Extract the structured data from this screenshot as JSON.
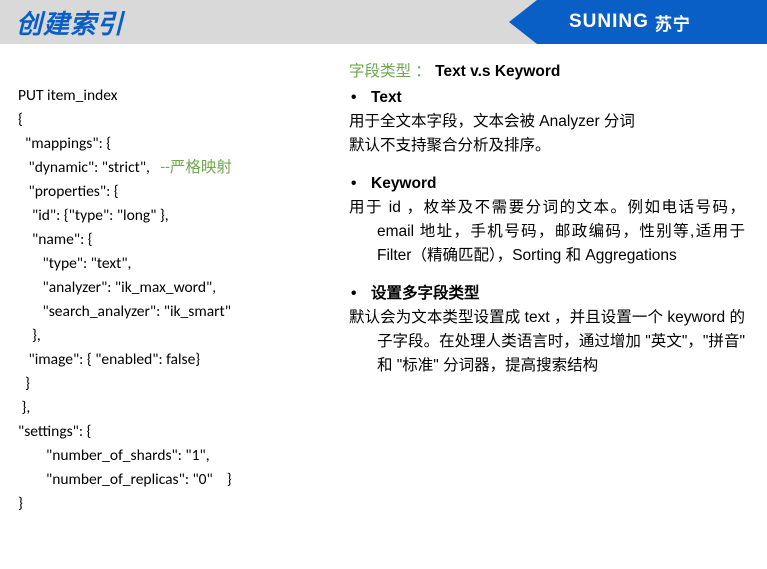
{
  "header": {
    "title": "创建索引",
    "brand_en": "SUNING",
    "brand_cn": "苏宁"
  },
  "code": {
    "l1": "PUT item_index",
    "l2": "{",
    "l3": "  \"mappings\": {",
    "l4a": "   \"dynamic\": \"strict\",   ",
    "l4b": "--严格映射",
    "l5": "   \"properties\": {",
    "l6": "    \"id\": {\"type\": \"long\" },",
    "l7": "    \"name\": {",
    "l8": "       \"type\": \"text\",",
    "l9": "       \"analyzer\": \"ik_max_word\",",
    "l10": "       \"search_analyzer\": \"ik_smart\"",
    "l11": "    },",
    "l12": "   \"image\": { \"enabled\": false}",
    "l13": "  }",
    "l14": " },",
    "l15": "\"settings\": {",
    "l16": "        \"number_of_shards\": \"1\",",
    "l17": "        \"number_of_replicas\": \"0\"    }",
    "l18": "}"
  },
  "right": {
    "section_label": "字段类型 ：",
    "section_kw": "Text v.s Keyword",
    "text_bullet": "Text",
    "text_desc1": "用于全文本字段，文本会被 Analyzer 分词",
    "text_desc2": "默认不支持聚合分析及排序。",
    "keyword_bullet": "Keyword",
    "keyword_desc1": "用于 id ，枚举及不需要分词的文本。例如电话号码，email 地址，手机号码，邮政编码，性别等,适用于 Filter（精确匹配），Sorting 和 Aggregations",
    "multi_bullet": "设置多字段类型",
    "multi_desc1": "默认会为文本类型设置成 text ，并且设置一个 keyword 的子字段。在处理人类语言时，通过增加 \"英文\"，\"拼音\" 和 \"标准\" 分词器，提高搜索结构"
  }
}
